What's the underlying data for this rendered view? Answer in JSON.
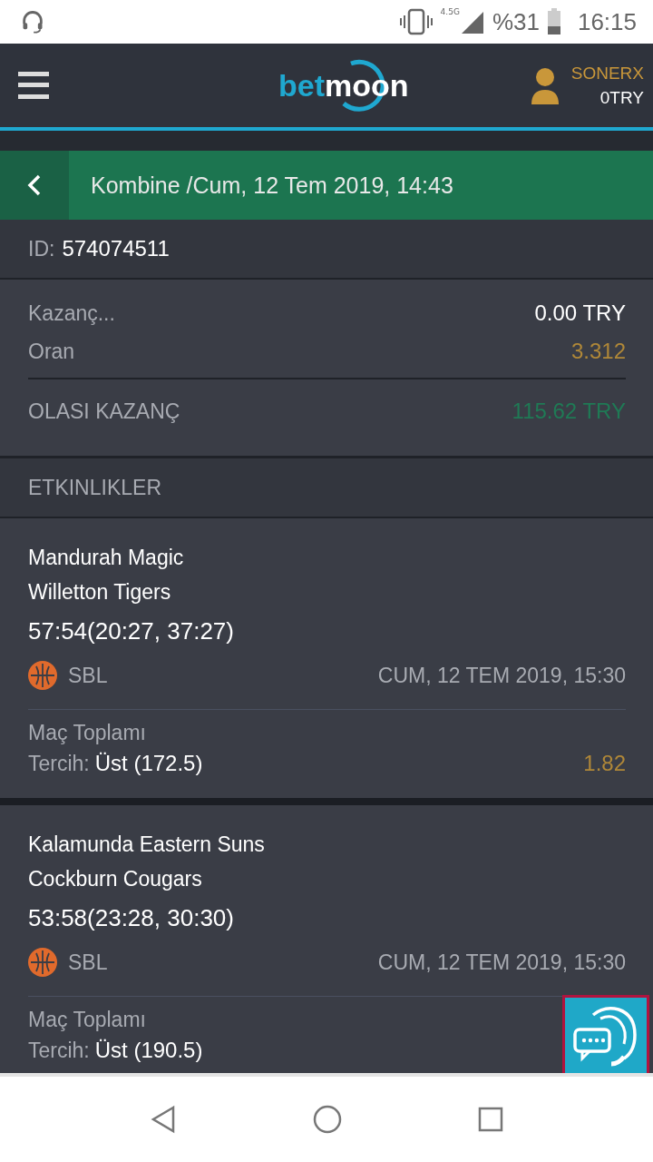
{
  "status_bar": {
    "battery": "%31",
    "time": "16:15",
    "network": "4.5G"
  },
  "header": {
    "logo": {
      "prefix": "bet",
      "suffix": "moon"
    },
    "user": {
      "name": "SONERX",
      "balance": "0TRY"
    }
  },
  "title_bar": {
    "title": "Kombine /Cum, 12 Tem 2019, 14:43"
  },
  "bet_id": {
    "label": "ID:",
    "value": "574074511"
  },
  "summary": {
    "rows": [
      {
        "label": "Kazanç...",
        "value": "0.00 TRY",
        "kind": "plain"
      },
      {
        "label": "Oran",
        "value": "3.312",
        "kind": "odds"
      }
    ],
    "total": {
      "label": "OLASI KAZANÇ",
      "value": "115.62 TRY"
    }
  },
  "events_header": "ETKINLIKLER",
  "events": [
    {
      "home": "Mandurah Magic",
      "away": "Willetton Tigers",
      "score": "57:54(20:27, 37:27)",
      "league": "SBL",
      "date": "CUM, 12 TEM 2019, 15:30",
      "market": "Maç Toplamı",
      "pick_label": "Tercih:",
      "pick": "Üst (172.5)",
      "odds": "1.82"
    },
    {
      "home": "Kalamunda Eastern Suns",
      "away": "Cockburn Cougars",
      "score": "53:58(23:28, 30:30)",
      "league": "SBL",
      "date": "CUM, 12 TEM 2019, 15:30",
      "market": "Maç Toplamı",
      "pick_label": "Tercih:",
      "pick": "Üst (190.5)"
    }
  ]
}
